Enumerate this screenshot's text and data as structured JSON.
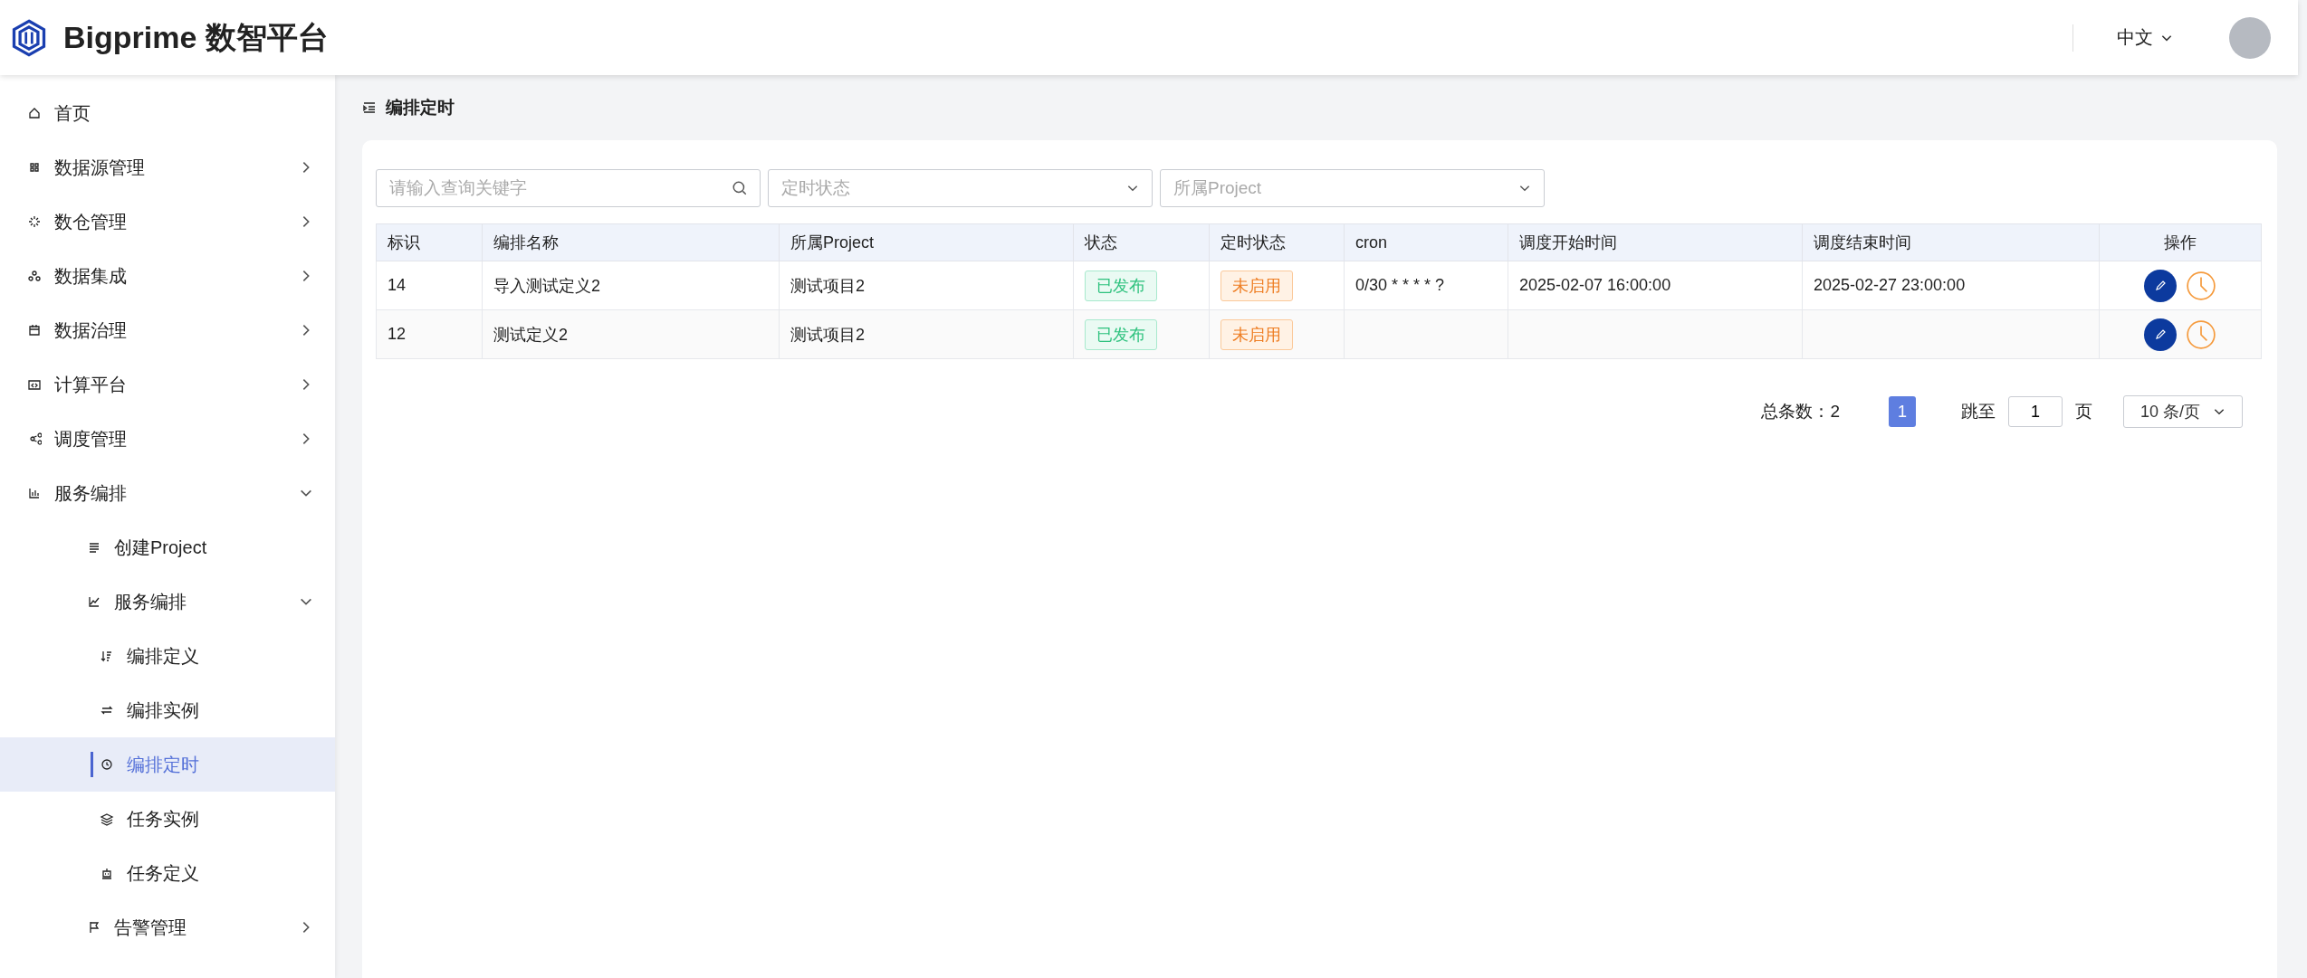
{
  "header": {
    "brand": "Bigprime 数智平台",
    "language": "中文"
  },
  "sidebar": {
    "items": [
      {
        "label": "首页",
        "selected": false
      },
      {
        "label": "数据源管理",
        "selected": false,
        "expanded": false
      },
      {
        "label": "数仓管理",
        "selected": false,
        "expanded": false
      },
      {
        "label": "数据集成",
        "selected": false,
        "expanded": false
      },
      {
        "label": "数据治理",
        "selected": false,
        "expanded": false
      },
      {
        "label": "计算平台",
        "selected": false,
        "expanded": false
      },
      {
        "label": "调度管理",
        "selected": false,
        "expanded": false
      },
      {
        "label": "服务编排",
        "selected": false,
        "expanded": true,
        "children": [
          {
            "label": "创建Project",
            "selected": false
          },
          {
            "label": "服务编排",
            "selected": false,
            "expanded": true,
            "children": [
              {
                "label": "编排定义",
                "selected": false
              },
              {
                "label": "编排实例",
                "selected": false
              },
              {
                "label": "编排定时",
                "selected": true
              },
              {
                "label": "任务实例",
                "selected": false
              },
              {
                "label": "任务定义",
                "selected": false
              }
            ]
          },
          {
            "label": "告警管理",
            "selected": false,
            "expanded": false
          }
        ]
      }
    ]
  },
  "page": {
    "title": "编排定时"
  },
  "filters": {
    "search": {
      "placeholder": "请输入查询关键字"
    },
    "timer_status": {
      "placeholder": "定时状态"
    },
    "project": {
      "placeholder": "所属Project"
    }
  },
  "table": {
    "columns": [
      "标识",
      "编排名称",
      "所属Project",
      "状态",
      "定时状态",
      "cron",
      "调度开始时间",
      "调度结束时间",
      "操作"
    ],
    "rows": [
      {
        "id": "14",
        "name": "导入测试定义2",
        "project": "测试项目2",
        "status": "已发布",
        "timer_status": "未启用",
        "cron": "0/30 * * * * ?",
        "start": "2025-02-07 16:00:00",
        "end": "2025-02-27 23:00:00"
      },
      {
        "id": "12",
        "name": "测试定义2",
        "project": "测试项目2",
        "status": "已发布",
        "timer_status": "未启用",
        "cron": "",
        "start": "",
        "end": ""
      }
    ]
  },
  "pagination": {
    "total_label": "总条数：2",
    "pages": [
      {
        "label": "1",
        "selected": true
      }
    ],
    "jump_label": "跳至",
    "jump_value": "1",
    "page_unit": "页",
    "page_size": "10 条/页"
  }
}
